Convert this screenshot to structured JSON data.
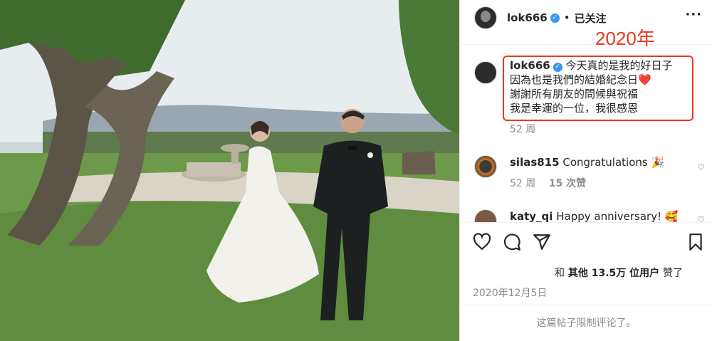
{
  "post": {
    "username": "lok666",
    "follow_status": "已关注",
    "annotation": "2020年",
    "caption": {
      "author": "lok666",
      "lines": [
        "今天真的是我的好日子",
        "因為也是我們的結婚紀念日❤️",
        "謝謝所有朋友的問候與祝福",
        "我是幸運的一位，我很感恩"
      ],
      "age": "52 周"
    },
    "comments": [
      {
        "author": "silas815",
        "text": "Congratulations 🎉",
        "age": "52 周",
        "likes": "15 次赞"
      },
      {
        "author": "katy_qi",
        "text": "Happy anniversary! 🥰"
      }
    ],
    "likes_text": {
      "prefix": "和",
      "count": "其他 13.5万 位用户",
      "suffix": "赞了"
    },
    "date": "2020年12月5日",
    "restricted": "这篇帖子限制评论了。",
    "icons": [
      "heart-icon",
      "comment-icon",
      "share-icon",
      "bookmark-icon",
      "more-icon",
      "verified-icon"
    ],
    "colors": {
      "accent": "#e53a1f",
      "verified": "#3897f0",
      "muted": "#8e8e8e"
    }
  }
}
